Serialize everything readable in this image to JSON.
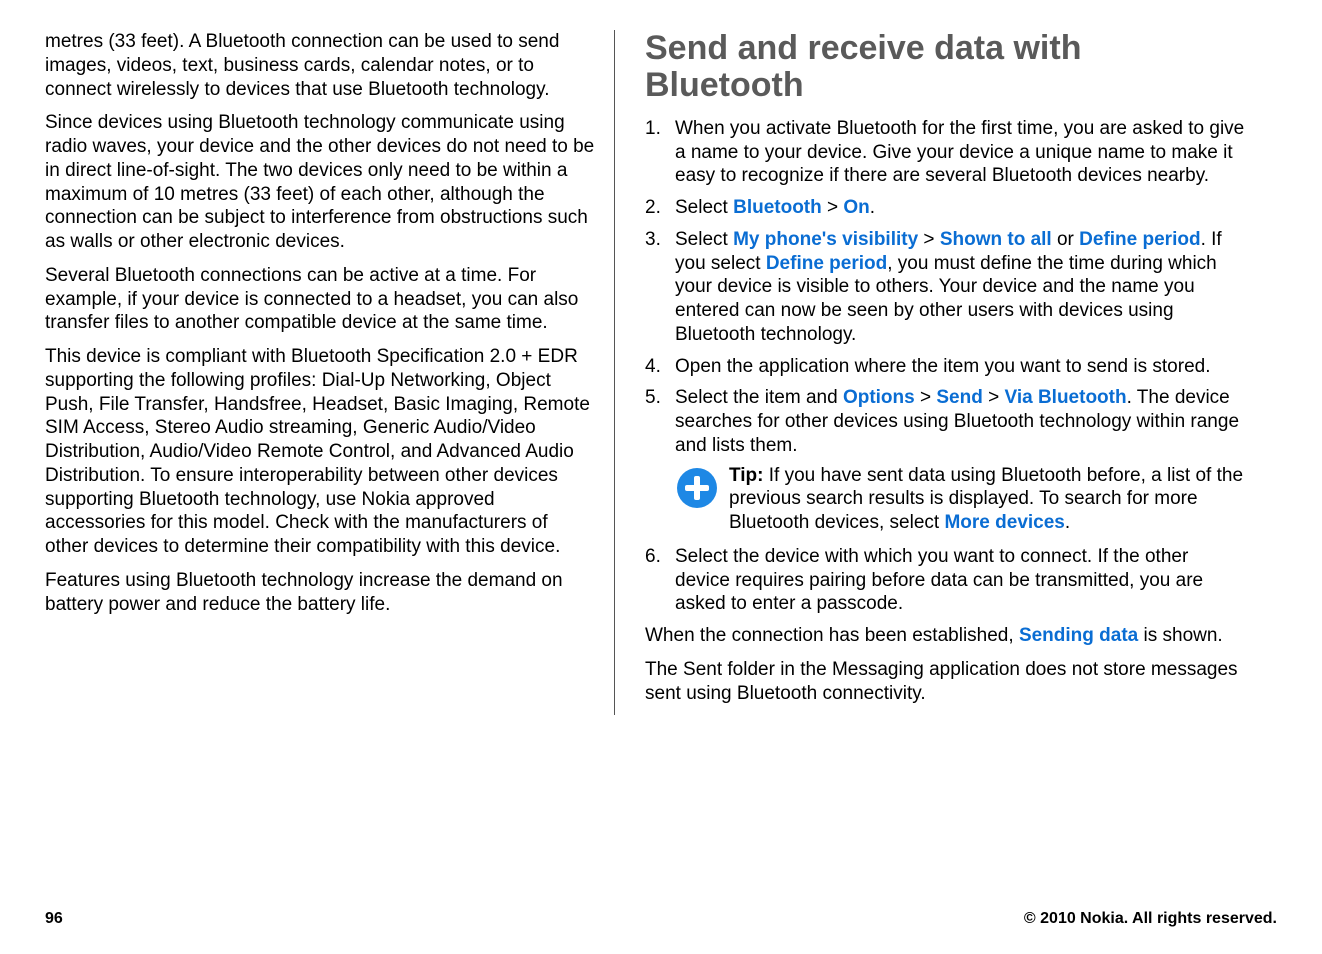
{
  "left": {
    "p1": "metres (33 feet). A Bluetooth connection can be used to send images, videos, text, business cards, calendar notes, or to connect wirelessly to devices that use Bluetooth technology.",
    "p2": "Since devices using Bluetooth technology communicate using radio waves, your device and the other devices do not need to be in direct line-of-sight. The two devices only need to be within a maximum of 10 metres (33 feet) of each other, although the connection can be subject to interference from obstructions such as walls or other electronic devices.",
    "p3": "Several Bluetooth connections can be active at a time. For example, if your device is connected to a headset, you can also transfer files to another compatible device at the same time.",
    "p4": "This device is compliant with Bluetooth Specification 2.0 + EDR supporting the following profiles: Dial-Up Networking, Object Push, File Transfer, Handsfree, Headset, Basic Imaging, Remote SIM Access, Stereo Audio streaming, Generic Audio/Video Distribution, Audio/Video Remote Control, and Advanced Audio Distribution. To ensure interoperability between other devices supporting Bluetooth technology, use Nokia approved accessories for this model. Check with the manufacturers of other devices to determine their compatibility with this device.",
    "p5": "Features using Bluetooth technology increase the demand on battery power and reduce the battery life."
  },
  "right": {
    "heading": "Send and receive data with Bluetooth",
    "steps": {
      "s1": "When you activate Bluetooth for the first time, you are asked to give a name to your device. Give your device a unique name to make it easy to recognize if there are several Bluetooth devices nearby.",
      "s2a": "Select ",
      "s2_kw1": "Bluetooth",
      "s2_sep": " > ",
      "s2_kw2": "On",
      "s2_end": ".",
      "s3a": "Select ",
      "s3_kw1": "My phone's visibility",
      "s3_sep1": " > ",
      "s3_kw2": "Shown to all",
      "s3_or": " or ",
      "s3_kw3": "Define period",
      "s3_mid": ". If you select ",
      "s3_kw4": "Define period",
      "s3_tail": ", you must define the time during which your device is visible to others. Your device and the name you entered can now be seen by other users with devices using Bluetooth technology.",
      "s4": "Open the application where the item you want to send is stored.",
      "s5a": "Select the item and ",
      "s5_kw1": "Options",
      "s5_sep1": " > ",
      "s5_kw2": "Send",
      "s5_sep2": " > ",
      "s5_kw3": "Via Bluetooth",
      "s5_tail": ". The device searches for other devices using Bluetooth technology within range and lists them.",
      "s6": "Select the device with which you want to connect. If the other device requires pairing before data can be transmitted, you are asked to enter a passcode."
    },
    "tip": {
      "label": "Tip: ",
      "text_a": "If you have sent data using Bluetooth before, a list of the previous search results is displayed. To search for more Bluetooth devices, select ",
      "kw": "More devices",
      "text_b": "."
    },
    "after1_a": "When the connection has been established, ",
    "after1_kw": "Sending data",
    "after1_b": " is shown.",
    "after2": "The Sent folder in the Messaging application does not store messages sent using Bluetooth connectivity."
  },
  "footer": {
    "page": "96",
    "copyright": "© 2010 Nokia. All rights reserved."
  }
}
